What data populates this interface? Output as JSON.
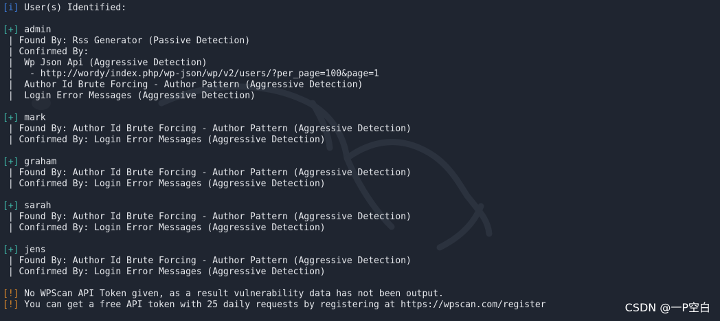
{
  "terminal": {
    "header": {
      "tag": "[i]",
      "text": " User(s) Identified:"
    },
    "users": [
      {
        "tag": "[+]",
        "name": " admin",
        "details": [
          " | Found By: Rss Generator (Passive Detection)",
          " | Confirmed By:",
          " |  Wp Json Api (Aggressive Detection)",
          " |   - http://wordy/index.php/wp-json/wp/v2/users/?per_page=100&page=1",
          " |  Author Id Brute Forcing - Author Pattern (Aggressive Detection)",
          " |  Login Error Messages (Aggressive Detection)"
        ]
      },
      {
        "tag": "[+]",
        "name": " mark",
        "details": [
          " | Found By: Author Id Brute Forcing - Author Pattern (Aggressive Detection)",
          " | Confirmed By: Login Error Messages (Aggressive Detection)"
        ]
      },
      {
        "tag": "[+]",
        "name": " graham",
        "details": [
          " | Found By: Author Id Brute Forcing - Author Pattern (Aggressive Detection)",
          " | Confirmed By: Login Error Messages (Aggressive Detection)"
        ]
      },
      {
        "tag": "[+]",
        "name": " sarah",
        "details": [
          " | Found By: Author Id Brute Forcing - Author Pattern (Aggressive Detection)",
          " | Confirmed By: Login Error Messages (Aggressive Detection)"
        ]
      },
      {
        "tag": "[+]",
        "name": " jens",
        "details": [
          " | Found By: Author Id Brute Forcing - Author Pattern (Aggressive Detection)",
          " | Confirmed By: Login Error Messages (Aggressive Detection)"
        ]
      }
    ],
    "warnings": [
      {
        "tag": "[!]",
        "text": " No WPScan API Token given, as a result vulnerability data has not been output."
      },
      {
        "tag": "[!]",
        "text": " You can get a free API token with 25 daily requests by registering at https://wpscan.com/register"
      }
    ]
  },
  "watermark": {
    "text": "CSDN @一P空白"
  },
  "colors": {
    "background": "#1f2530",
    "text": "#e6e8ec",
    "info_tag": "#3f7fe0",
    "success_tag": "#3fb8a8",
    "warning_tag": "#e08a2a",
    "background_dragon": "#2a313d"
  },
  "icons": {
    "background": "kali-dragon-icon"
  }
}
